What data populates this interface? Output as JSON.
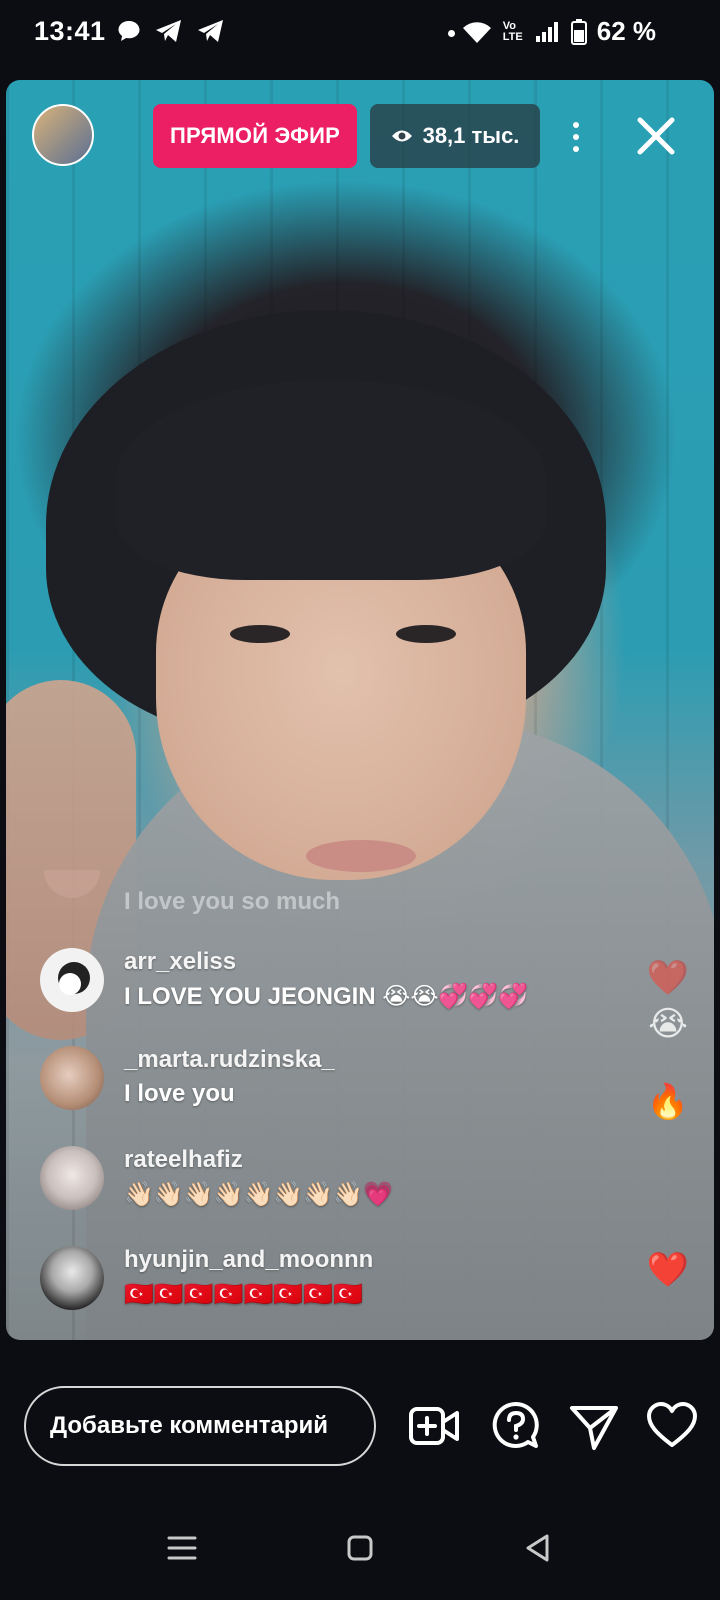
{
  "status_bar": {
    "time": "13:41",
    "left_icons": [
      "chat-bubble-icon",
      "telegram-icon",
      "telegram-icon"
    ],
    "network": "Vo LTE",
    "battery": "62 %"
  },
  "live": {
    "badge_label": "ПРЯМОЙ ЭФИР",
    "viewers_label": "38,1 тыс.",
    "colors": {
      "badge": "#ec1e64",
      "background": "#0b0d12"
    }
  },
  "comments": {
    "faded_text": "I love you so much",
    "items": [
      {
        "user": "arr_xeliss",
        "text": "I LOVE YOU JEONGIN 😭😭💞💞💞"
      },
      {
        "user": "_marta.rudzinska_",
        "text": "I love you"
      },
      {
        "user": "rateelhafiz",
        "text": "👋🏻👋🏻👋🏻👋🏻👋🏻👋🏻👋🏻👋🏻💗"
      },
      {
        "user": "hyunjin_and_moonnn",
        "text": "🇹🇷🇹🇷🇹🇷🇹🇷🇹🇷🇹🇷🇹🇷🇹🇷"
      }
    ]
  },
  "reactions": [
    "❤️",
    "😭",
    "🔥",
    "❤️"
  ],
  "bottom_bar": {
    "comment_placeholder": "Добавьте комментарий",
    "actions": [
      "add-video-icon",
      "question-icon",
      "send-icon",
      "heart-icon"
    ]
  },
  "nav_bar": [
    "recents-icon",
    "home-icon",
    "back-icon"
  ]
}
